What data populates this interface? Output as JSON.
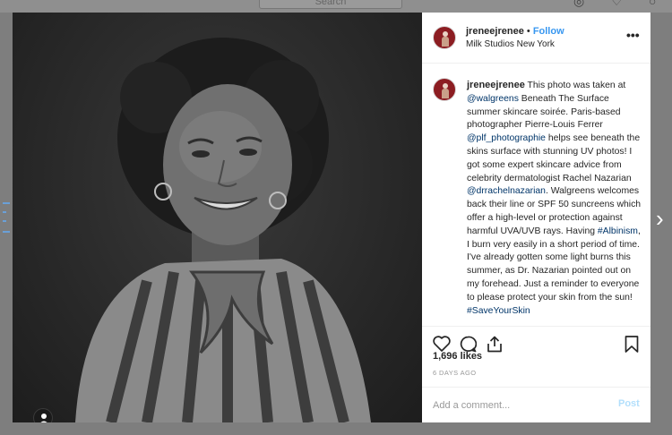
{
  "background": {
    "search_placeholder": "Search",
    "colors": {
      "dim_overlay": "#7e7e7e"
    }
  },
  "post": {
    "username": "jreneejrenee",
    "separator": "•",
    "follow_label": "Follow",
    "location": "Milk Studios New York",
    "more_icon": "more-icon",
    "caption": {
      "username": "jreneejrenee",
      "segments": [
        {
          "text": " This photo was taken at ",
          "link": false
        },
        {
          "text": "@walgreens",
          "link": true
        },
        {
          "text": " Beneath The Surface summer skincare soirée. Paris-based photographer Pierre-Louis Ferrer ",
          "link": false
        },
        {
          "text": "@plf_photographie",
          "link": true
        },
        {
          "text": " helps see beneath the skins surface with stunning UV photos! I got some expert skincare advice from celebrity dermatologist Rachel Nazarian ",
          "link": false
        },
        {
          "text": "@drrachelnazarian",
          "link": true
        },
        {
          "text": ". Walgreens welcomes back their line or SPF 50 suncreens which offer a high-level or protection against harmful UVA/UVB rays. Having ",
          "link": false
        },
        {
          "text": "#Albinism",
          "link": true
        },
        {
          "text": ", I burn very easily in a short period of time. I've already gotten some light burns this summer, as Dr. Nazarian pointed out on my forehead. Just a reminder to everyone to please protect your skin from the sun! ",
          "link": false
        },
        {
          "text": "#SaveYourSkin",
          "link": true
        }
      ]
    },
    "likes": "1,696 likes",
    "time": "6 DAYS AGO",
    "comment_placeholder": "Add a comment...",
    "post_label": "Post",
    "icons": [
      "heart-icon",
      "comment-icon",
      "share-icon",
      "bookmark-icon",
      "user-tag-icon",
      "next-arrow-icon"
    ],
    "colors": {
      "link": "#003569",
      "follow": "#3897f0",
      "post_disabled": "#b2dffc",
      "muted": "#999999"
    }
  }
}
